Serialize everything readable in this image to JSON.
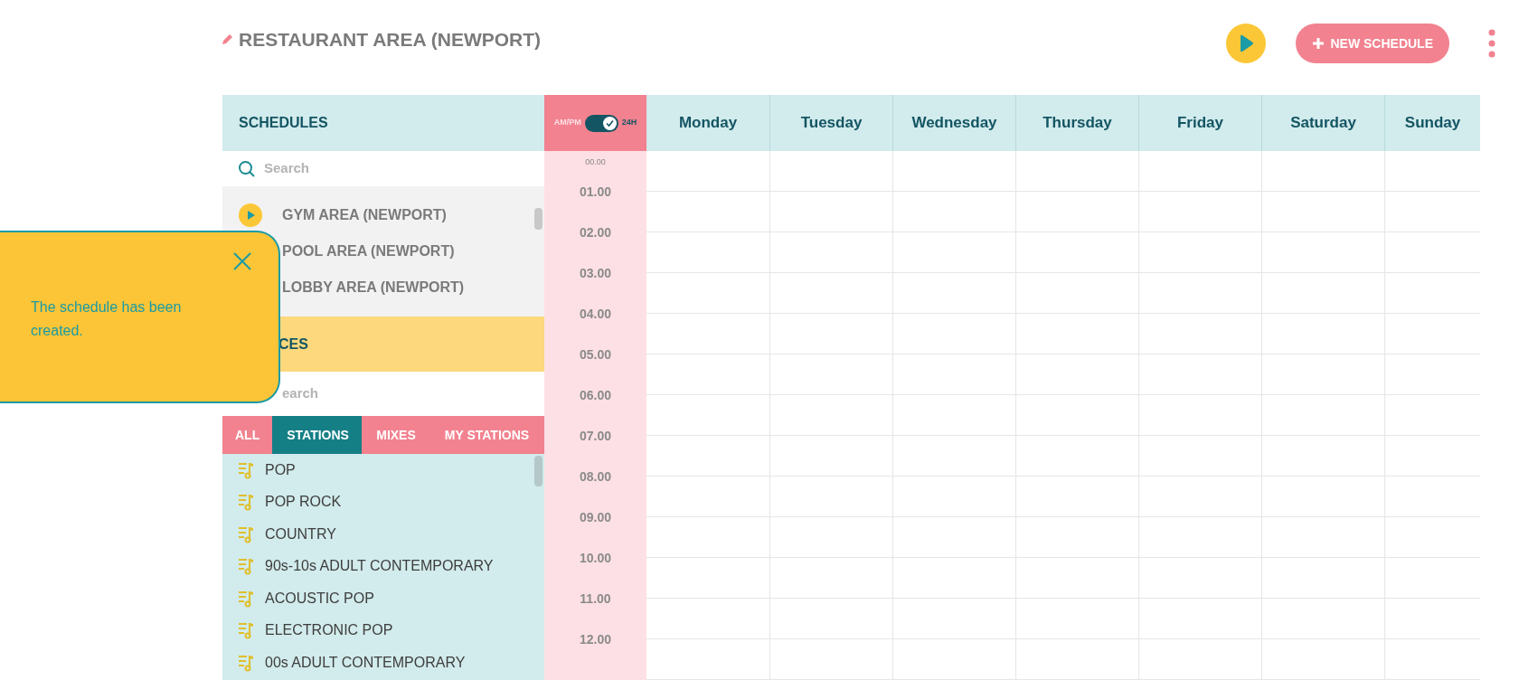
{
  "title": "RESTAURANT AREA (NEWPORT)",
  "new_schedule": "NEW SCHEDULE",
  "schedules": {
    "heading": "SCHEDULES",
    "search": {
      "placeholder": "Search"
    },
    "items": [
      {
        "name": "GYM AREA (NEWPORT)",
        "playing": true
      },
      {
        "name": "POOL AREA (NEWPORT)"
      },
      {
        "name": "LOBBY AREA (NEWPORT)"
      }
    ]
  },
  "sources": {
    "heading": "CES",
    "search": {
      "placeholder": "earch"
    },
    "tabs": [
      {
        "label": "ALL",
        "selected": false
      },
      {
        "label": "STATIONS",
        "selected": true
      },
      {
        "label": "MIXES",
        "selected": false
      },
      {
        "label": "MY STATIONS",
        "selected": false
      }
    ],
    "items": [
      "POP",
      "POP ROCK",
      "COUNTRY",
      "90s-10s ADULT CONTEMPORARY",
      "ACOUSTIC POP",
      "ELECTRONIC POP",
      "00s ADULT CONTEMPORARY"
    ]
  },
  "time_format": {
    "left": "AM/PM",
    "right": "24H",
    "on": true
  },
  "days": [
    "Monday",
    "Tuesday",
    "Wednesday",
    "Thursday",
    "Friday",
    "Saturday",
    "Sunday"
  ],
  "hours": [
    "00.00",
    "01.00",
    "02.00",
    "03.00",
    "04.00",
    "05.00",
    "06.00",
    "07.00",
    "08.00",
    "09.00",
    "10.00",
    "11.00",
    "12.00"
  ],
  "toast": {
    "message": "The schedule has been created."
  }
}
